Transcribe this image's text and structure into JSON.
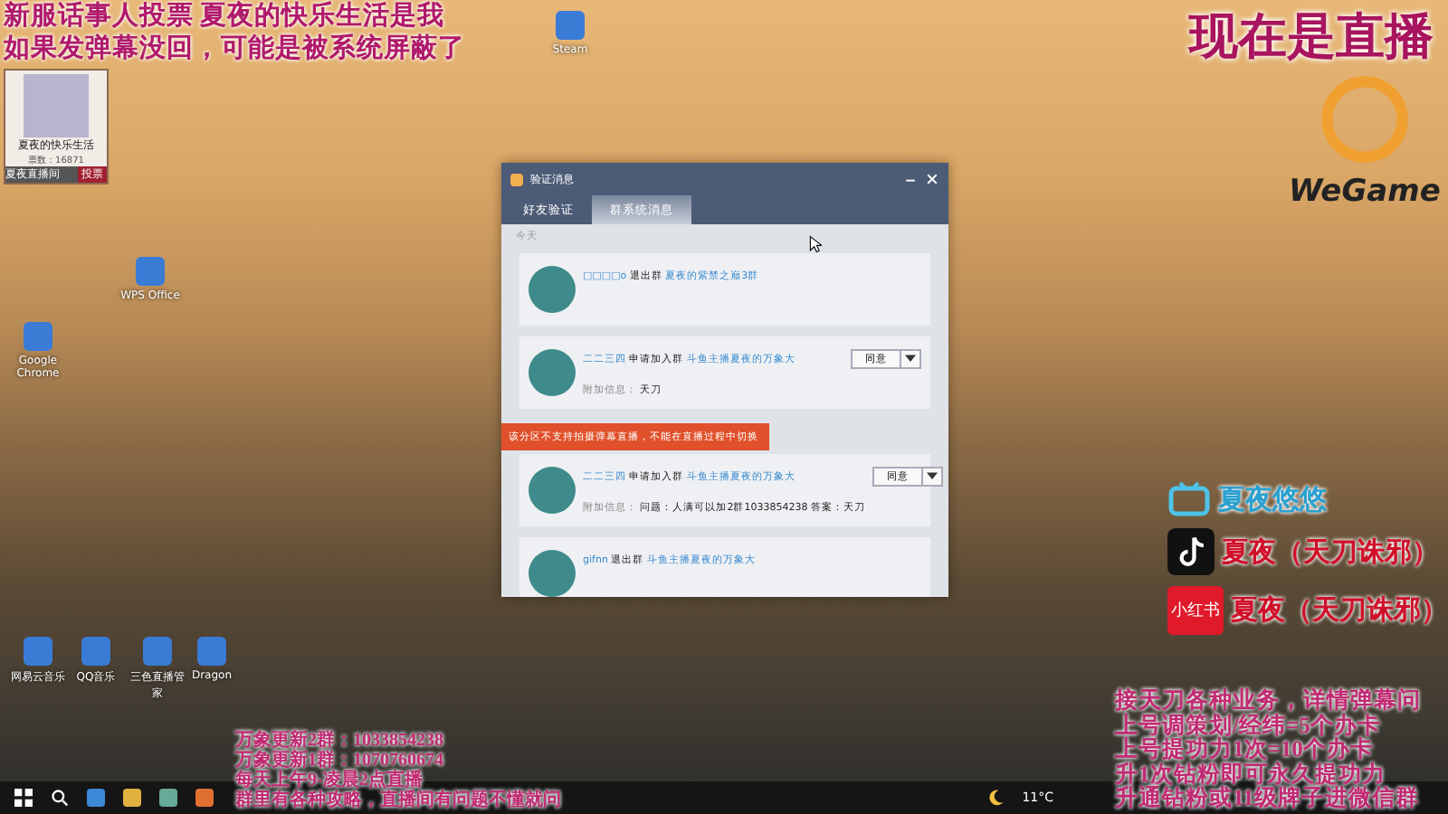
{
  "overlay_top_left": [
    "新服话事人投票 夏夜的快乐生活是我",
    "如果发弹幕没回，可能是被系统屏蔽了"
  ],
  "vote_card": {
    "name": "夏夜的快乐生活",
    "votes": "票数：16871",
    "footer_left": "夏夜直播间",
    "button": "投票"
  },
  "overlay_top_right": "现在是直播",
  "wegame_logo": "WeGame",
  "social": [
    {
      "kind": "bilibili",
      "handle": "夏夜悠悠"
    },
    {
      "kind": "douyin",
      "handle": "夏夜（天刀诛邪）"
    },
    {
      "kind": "xiaohongshu",
      "badge": "小红书",
      "handle": "夏夜（天刀诛邪）"
    }
  ],
  "desktop_icons": [
    {
      "label": "Steam",
      "kind": "app"
    },
    {
      "label": "WPS Office",
      "kind": "app"
    },
    {
      "label": "Google Chrome",
      "kind": "app"
    },
    {
      "label": "网易云音乐",
      "kind": "app"
    },
    {
      "label": "QQ音乐",
      "kind": "app"
    },
    {
      "label": "三色直播管家",
      "kind": "app"
    },
    {
      "label": "Dragon",
      "kind": "app"
    }
  ],
  "dialog": {
    "title": "验证消息",
    "tabs": [
      {
        "label": "好友验证",
        "selected": false
      },
      {
        "label": "群系统消息",
        "selected": true
      }
    ],
    "section": "今天",
    "messages": [
      {
        "user": "□□□□o",
        "action": "退出群",
        "group": "夏夜的紫禁之巅3群"
      },
      {
        "user": "二二三四",
        "action": "申请加入群",
        "group": "斗鱼主播夏夜的万象大",
        "info_label": "附加信息：",
        "info": "天刀",
        "button": "同意"
      },
      {
        "user": "二二三四",
        "action": "申请加入群",
        "group": "斗鱼主播夏夜的万象大",
        "info_label": "附加信息：",
        "info": "问题：人满可以加2群1033854238 答案：天刀",
        "button": "同意"
      },
      {
        "user": "gifnn",
        "action": "退出群",
        "group": "斗鱼主播夏夜的万象大"
      }
    ],
    "toast": "该分区不支持拍摄弹幕直播，不能在直播过程中切换"
  },
  "overlay_bottom_left": [
    "万象更新2群：1033854238",
    "万象更新1群：1070760674",
    "每天上午9-凌晨2点直播",
    "群里有各种攻略，直播间有问题不懂就问"
  ],
  "overlay_bottom_right": [
    "接天刀各种业务，详情弹幕问",
    "上号调策划/经纬=5个办卡",
    "上号提功力1次=10个办卡",
    "升1次钻粉即可永久提功力",
    "升通钻粉或11级牌子进微信群"
  ],
  "taskbar": {
    "weather": "11°C"
  }
}
